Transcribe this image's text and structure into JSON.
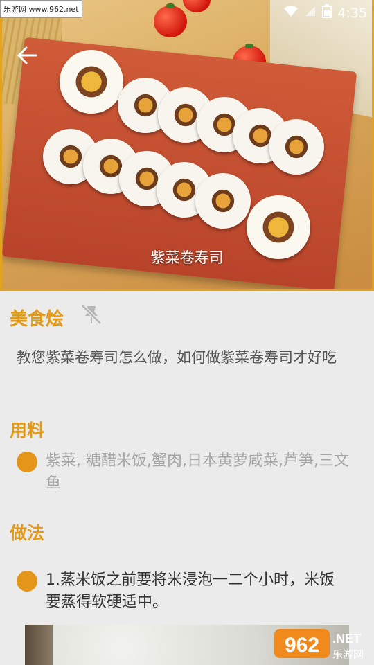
{
  "status_bar": {
    "watermark": "乐游网 www.962.net",
    "time": "4:35"
  },
  "hero": {
    "caption": "紫菜卷寿司"
  },
  "app": {
    "site_name": "美食烩"
  },
  "recipe": {
    "description": "教您紫菜卷寿司怎么做，如何做紫菜卷寿司才好吃",
    "ingredients_heading": "用料",
    "ingredients": "紫菜, 糖醋米饭,蟹肉,日本黄萝咸菜,芦笋,三文鱼",
    "method_heading": "做法",
    "steps": [
      {
        "text": "1.蒸米饭之前要将米浸泡一二个小时，米饭要蒸得软硬适中。"
      }
    ]
  },
  "watermark_bottom": {
    "number": "962",
    "suffix": ".NET",
    "cn": "乐游网"
  },
  "colors": {
    "accent": "#e29a1a",
    "background": "#ebebeb"
  },
  "icons": [
    "back-arrow-icon",
    "unpin-icon",
    "wifi-icon",
    "battery-icon"
  ]
}
